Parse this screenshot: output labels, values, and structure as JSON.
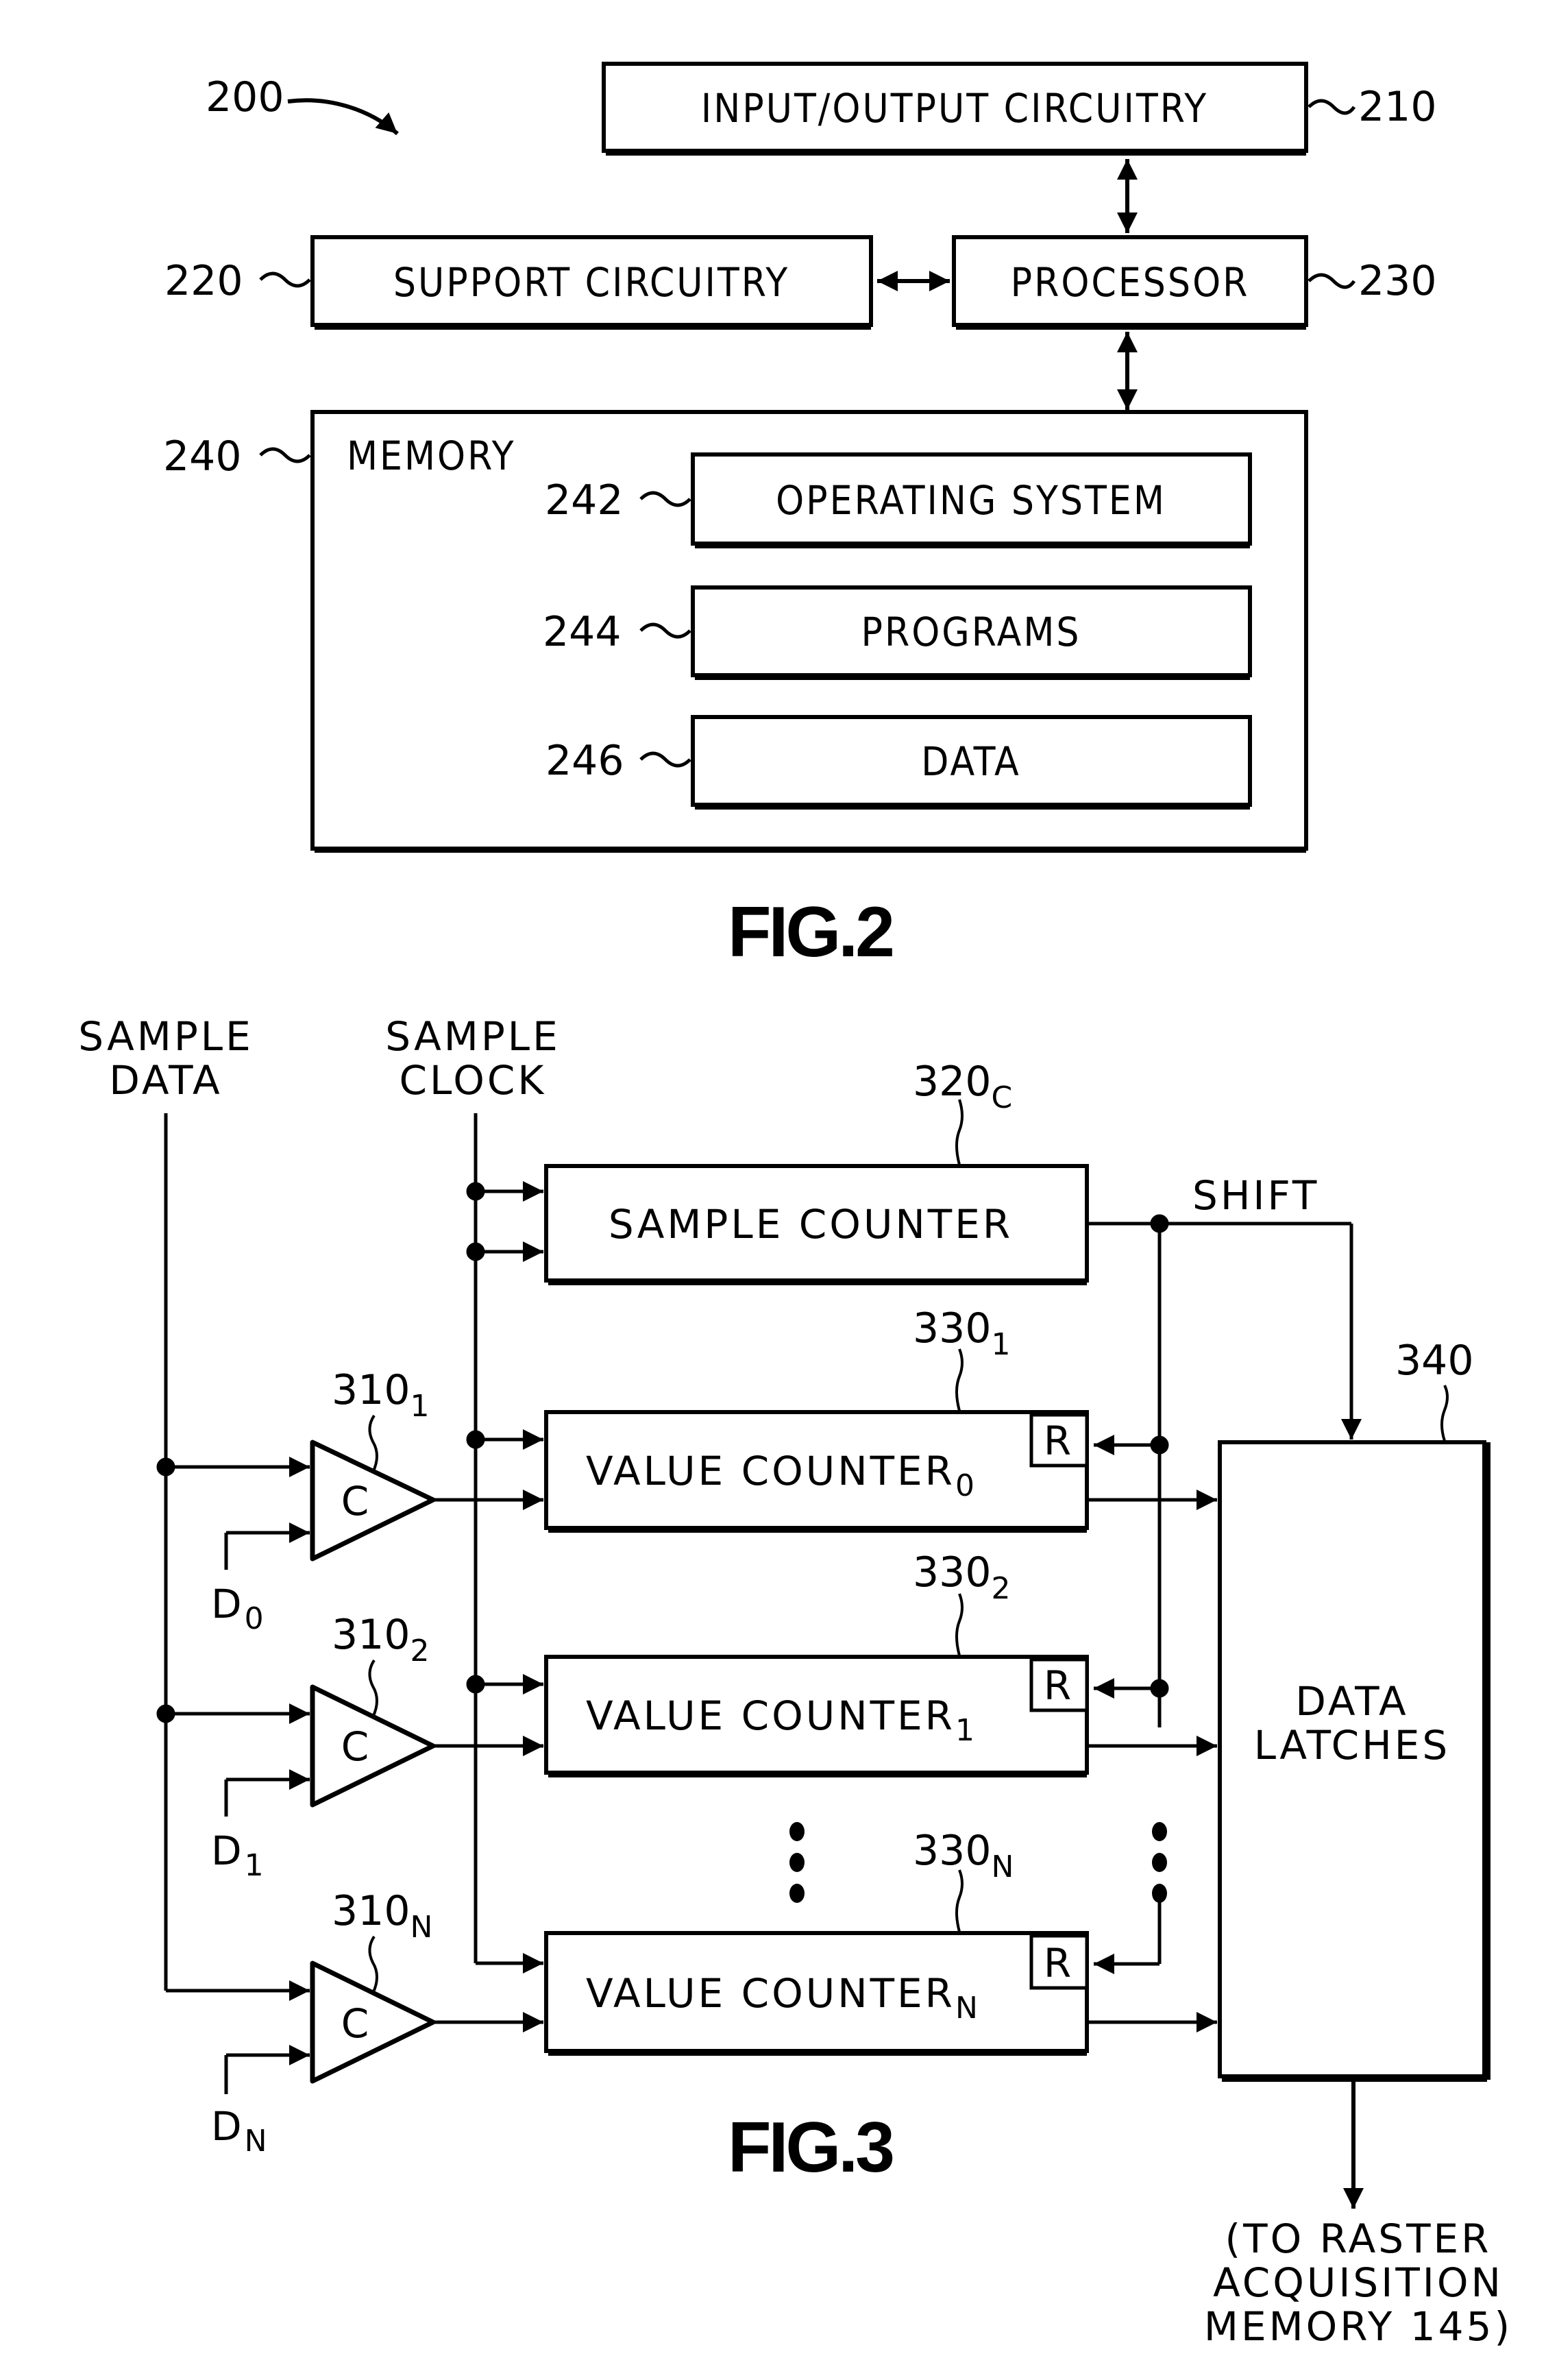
{
  "fig2": {
    "caption": "FIG.2",
    "system_ref": "200",
    "blocks": {
      "io": {
        "label": "INPUT/OUTPUT CIRCUITRY",
        "ref": "210"
      },
      "support": {
        "label": "SUPPORT CIRCUITRY",
        "ref": "220"
      },
      "processor": {
        "label": "PROCESSOR",
        "ref": "230"
      },
      "memory": {
        "label": "MEMORY",
        "ref": "240"
      },
      "os": {
        "label": "OPERATING SYSTEM",
        "ref": "242"
      },
      "programs": {
        "label": "PROGRAMS",
        "ref": "244"
      },
      "data": {
        "label": "DATA",
        "ref": "246"
      }
    }
  },
  "fig3": {
    "caption": "FIG.3",
    "inputs": {
      "sample_data": [
        "SAMPLE",
        "DATA"
      ],
      "sample_clock": [
        "SAMPLE",
        "CLOCK"
      ]
    },
    "sample_counter": {
      "label": "SAMPLE COUNTER",
      "ref": "320",
      "ref_sub": "C"
    },
    "shift_label": "SHIFT",
    "comparators": [
      {
        "symbol": "C",
        "ref": "310",
        "ref_sub": "1",
        "threshold": "D",
        "threshold_sub": "0"
      },
      {
        "symbol": "C",
        "ref": "310",
        "ref_sub": "2",
        "threshold": "D",
        "threshold_sub": "1"
      },
      {
        "symbol": "C",
        "ref": "310",
        "ref_sub": "N",
        "threshold": "D",
        "threshold_sub": "N"
      }
    ],
    "value_counters": [
      {
        "label": "VALUE COUNTER",
        "label_sub": "0",
        "ref": "330",
        "ref_sub": "1",
        "reset": "R"
      },
      {
        "label": "VALUE COUNTER",
        "label_sub": "1",
        "ref": "330",
        "ref_sub": "2",
        "reset": "R"
      },
      {
        "label": "VALUE COUNTER",
        "label_sub": "N",
        "ref": "330",
        "ref_sub": "N",
        "reset": "R"
      }
    ],
    "data_latches": {
      "label": [
        "DATA",
        "LATCHES"
      ],
      "ref": "340"
    },
    "output_note": [
      "(TO RASTER",
      "ACQUISITION",
      "MEMORY 145)"
    ]
  }
}
